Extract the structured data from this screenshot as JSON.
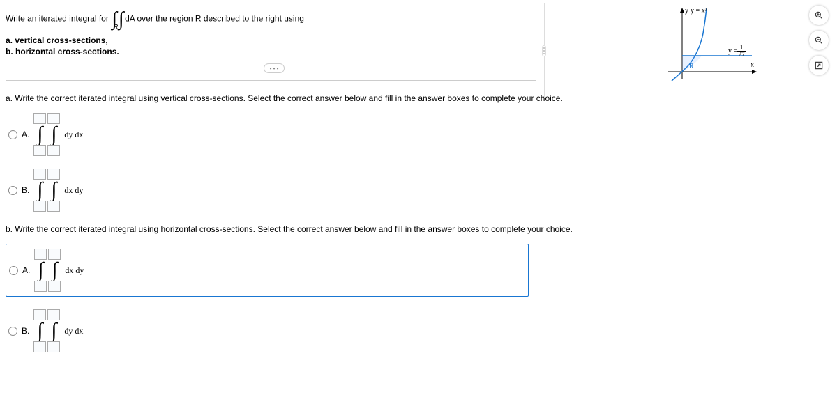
{
  "question": {
    "prefix": "Write an iterated integral for ",
    "integral_sub": "R",
    "integral_post": "dA",
    "suffix": " over the region R described to the right using",
    "items": {
      "a": "a. vertical cross-sections,",
      "b": "b. horizontal cross-sections."
    }
  },
  "graph": {
    "y_label": "y",
    "x_label": "x",
    "curve_label": "y = x³",
    "line_label_pre": "y = ",
    "line_label_num": "1",
    "line_label_den": "27",
    "region": "R"
  },
  "parts": {
    "a": {
      "prompt": "a. Write the correct iterated integral using vertical cross-sections. Select the correct answer below and fill in the answer boxes to complete your choice.",
      "opts": {
        "A": "A.",
        "B": "B."
      },
      "diffs": {
        "A": "dy dx",
        "B": "dx dy"
      }
    },
    "b": {
      "prompt": "b. Write the correct iterated integral using horizontal cross-sections. Select the correct answer below and fill in the answer boxes to complete your choice.",
      "opts": {
        "A": "A.",
        "B": "B."
      },
      "diffs": {
        "A": "dx dy",
        "B": "dy dx"
      }
    }
  },
  "icons": {
    "zoom_in": "zoom-in-icon",
    "zoom_out": "zoom-out-icon",
    "pop": "popout-icon"
  }
}
